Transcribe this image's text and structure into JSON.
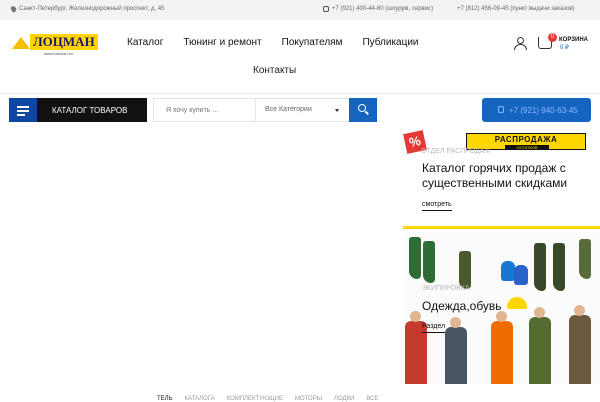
{
  "topbar": {
    "address": "Санкт-Петербург, Железнодорожный проспект, д. 45",
    "phone1": "+7 (921) 400-44-80 (шоурум, сервис)",
    "phone2": "+7 (812) 456-09-45 (пункт выдачи заказов)"
  },
  "logo": {
    "name": "ЛОЦМАН",
    "site": "www.lotsman.su"
  },
  "nav": {
    "items": [
      "Каталог",
      "Тюнинг и ремонт",
      "Покупателям",
      "Публикации"
    ],
    "second_row": "Контакты"
  },
  "cart": {
    "label": "КОРЗИНА",
    "sum": "0 ₽",
    "count": "0"
  },
  "search": {
    "catalog_label": "КАТАЛОГ ТОВАРОВ",
    "placeholder": "Я хочу купить ...",
    "category": "Все Категории"
  },
  "call": {
    "phone": "+7 (921) 940-63-45"
  },
  "banner1": {
    "badge": "%",
    "sale_title": "РАСПРОДАЖА",
    "sale_sub": "ОСТАТКОВ",
    "dept": "ОТДЕЛ РАСПРОДАЖ",
    "heading": "Каталог горячих продаж с существенными скидками",
    "more": "смотреть"
  },
  "banner2": {
    "category": "ЭКИПИРОВКА",
    "heading": "Одежда,обувь",
    "more": "Раздел"
  },
  "bottomnav": [
    "ТЕЛЬ",
    "КАТАЛОГА",
    "КОМПЛЕКТУЮЩИЕ",
    "МОТОРЫ",
    "ЛОДКИ",
    "ВСЕ"
  ],
  "colors": {
    "brand_blue": "#1565c0",
    "accent_yellow": "#ffd600",
    "sale_red": "#e53935"
  }
}
